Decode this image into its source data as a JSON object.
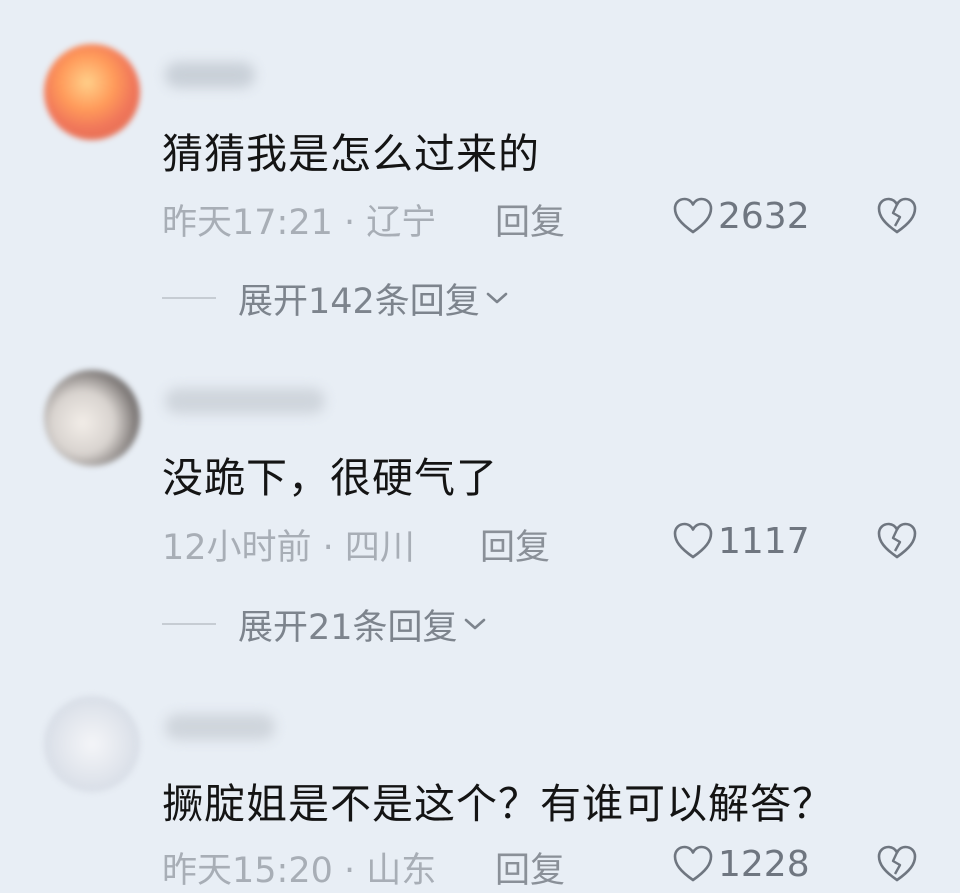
{
  "comments": [
    {
      "text": "猜猜我是怎么过来的",
      "meta": "昨天17:21 · 辽宁",
      "reply_label": "回复",
      "likes": "2632",
      "expand_label": "展开142条回复"
    },
    {
      "text": "没跪下，很硬气了",
      "meta": "12小时前 · 四川",
      "reply_label": "回复",
      "likes": "1117",
      "expand_label": "展开21条回复"
    },
    {
      "text": "撅腚姐是不是这个？有谁可以解答？",
      "meta": "昨天15:20 · 山东",
      "reply_label": "回复",
      "likes": "1228"
    }
  ],
  "icons": {
    "like": "heart-outline-icon",
    "dislike": "broken-heart-icon",
    "expand": "chevron-down-icon"
  },
  "colors": {
    "background": "#e8eef5",
    "text": "#141414",
    "meta": "#a8aeb6"
  }
}
